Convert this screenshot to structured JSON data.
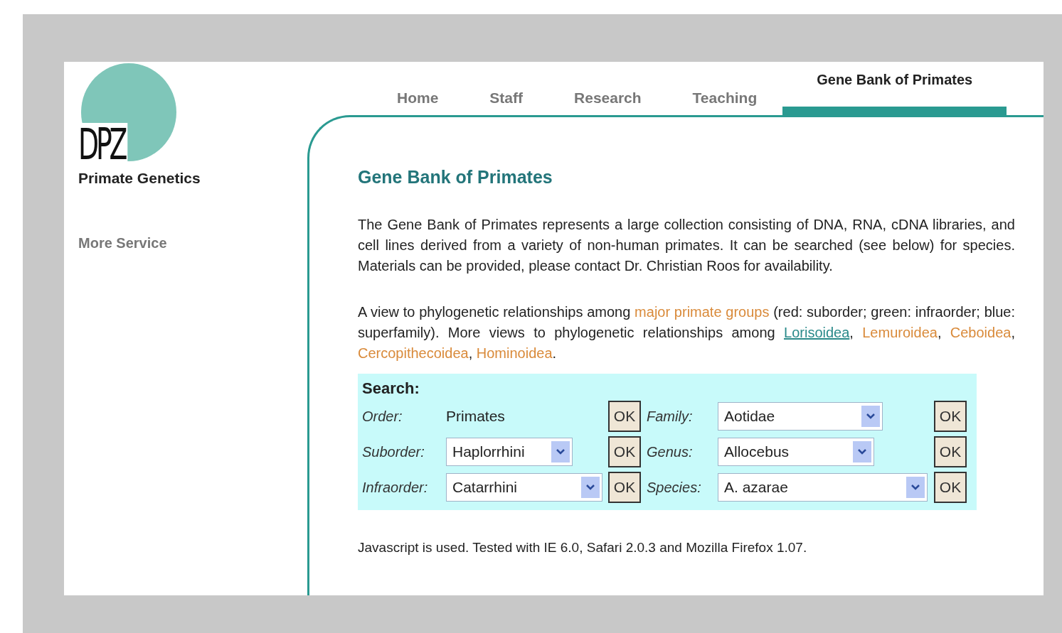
{
  "logo": {
    "mark": "DPZ",
    "subtitle": "Primate Genetics"
  },
  "sidebar": {
    "items": [
      {
        "label": "More Service"
      }
    ]
  },
  "tabs": [
    {
      "label": "Home",
      "selected": false
    },
    {
      "label": "Staff",
      "selected": false
    },
    {
      "label": "Research",
      "selected": false
    },
    {
      "label": "Teaching",
      "selected": false
    },
    {
      "label": "Gene Bank of Primates",
      "selected": true
    }
  ],
  "heading": "Gene Bank of Primates",
  "intro": "The Gene Bank of Primates represents a large collection consisting of DNA, RNA, cDNA libraries, and cell lines derived from a variety of non-human primates. It can be searched (see below) for species. Materials can be provided, please contact Dr. Christian Roos for availability.",
  "relations": [
    {
      "kind": "plain",
      "text": "A view to phylogenetic relationships among "
    },
    {
      "kind": "link",
      "text": "major primate groups"
    },
    {
      "kind": "plain",
      "text": " (red: suborder; green: infraorder; blue: superfamily). More views to phylogenetic relationships among "
    },
    {
      "kind": "visited",
      "text": "Lorisoidea"
    },
    {
      "kind": "plain",
      "text": ", "
    },
    {
      "kind": "link",
      "text": "Lemuroidea"
    },
    {
      "kind": "plain",
      "text": ", "
    },
    {
      "kind": "link",
      "text": "Ceboidea"
    },
    {
      "kind": "plain",
      "text": ", "
    },
    {
      "kind": "link",
      "text": "Cercopithecoidea"
    },
    {
      "kind": "plain",
      "text": ", "
    },
    {
      "kind": "link",
      "text": "Hominoidea"
    },
    {
      "kind": "plain",
      "text": "."
    }
  ],
  "search": {
    "title": "Search:",
    "fields": [
      {
        "label": "Order:",
        "kind": "text",
        "value": "Primates",
        "button": "OK"
      },
      {
        "label": "Family:",
        "kind": "select",
        "value": "Aotidae",
        "button": "OK"
      },
      {
        "label": "Suborder:",
        "kind": "select",
        "value": "Haplorrhini",
        "button": "OK"
      },
      {
        "label": "Genus:",
        "kind": "select",
        "value": "Allocebus",
        "button": "OK"
      },
      {
        "label": "Infraorder:",
        "kind": "select",
        "value": "Catarrhini",
        "button": "OK"
      },
      {
        "label": "Species:",
        "kind": "select",
        "value": "A. azarae",
        "button": "OK"
      }
    ]
  },
  "footer_note": "Javascript is used. Tested with IE 6.0, Safari 2.0.3 and Mozilla Firefox 1.07."
}
